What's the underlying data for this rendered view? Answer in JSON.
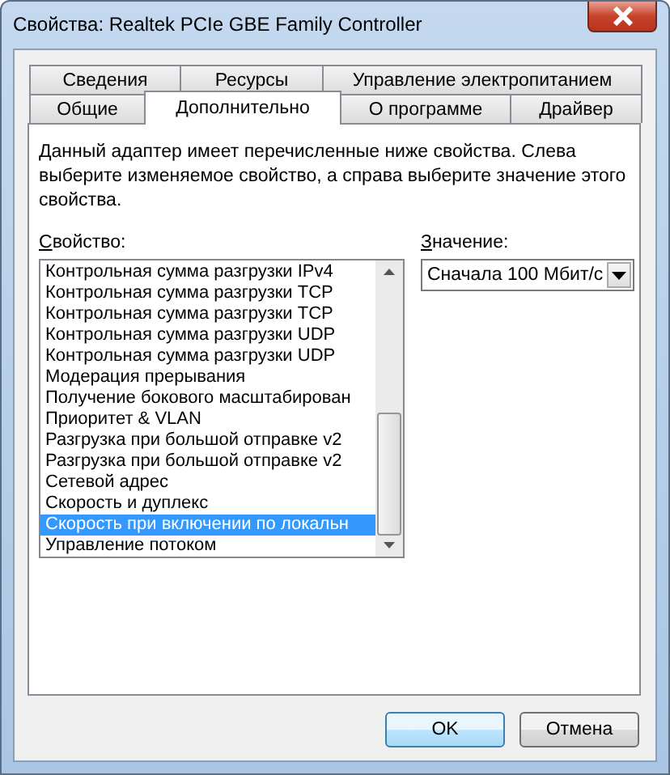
{
  "window": {
    "title": "Свойства: Realtek PCIe GBE Family Controller"
  },
  "tab_rows": [
    [
      {
        "label": "Сведения",
        "selected": false
      },
      {
        "label": "Ресурсы",
        "selected": false
      },
      {
        "label": "Управление электропитанием",
        "selected": false
      }
    ],
    [
      {
        "label": "Общие",
        "selected": false
      },
      {
        "label": "Дополнительно",
        "selected": true
      },
      {
        "label": "О программе",
        "selected": false
      },
      {
        "label": "Драйвер",
        "selected": false
      }
    ]
  ],
  "description": "Данный адаптер имеет перечисленные ниже свойства. Слева выберите изменяемое свойство, а справа выберите значение этого свойства.",
  "property": {
    "label": "Свойство:",
    "items": [
      {
        "label": "Контрольная сумма разгрузки IPv4",
        "selected": false
      },
      {
        "label": "Контрольная сумма разгрузки TCP",
        "selected": false
      },
      {
        "label": "Контрольная сумма разгрузки TCP",
        "selected": false
      },
      {
        "label": "Контрольная сумма разгрузки UDP",
        "selected": false
      },
      {
        "label": "Контрольная сумма разгрузки UDP",
        "selected": false
      },
      {
        "label": "Модерация прерывания",
        "selected": false
      },
      {
        "label": "Получение бокового масштабирован",
        "selected": false
      },
      {
        "label": "Приоритет & VLAN",
        "selected": false
      },
      {
        "label": "Разгрузка при большой отправке v2",
        "selected": false
      },
      {
        "label": "Разгрузка при большой отправке v2",
        "selected": false
      },
      {
        "label": "Сетевой адрес",
        "selected": false
      },
      {
        "label": "Скорость и дуплекс",
        "selected": false
      },
      {
        "label": "Скорость при включении по локальн",
        "selected": true
      },
      {
        "label": "Управление потоком",
        "selected": false
      }
    ]
  },
  "value": {
    "label": "Значение:",
    "value": "Сначала 100 Мбит/с"
  },
  "buttons": [
    {
      "label": "OK",
      "default": true
    },
    {
      "label": "Отмена",
      "default": false
    }
  ]
}
